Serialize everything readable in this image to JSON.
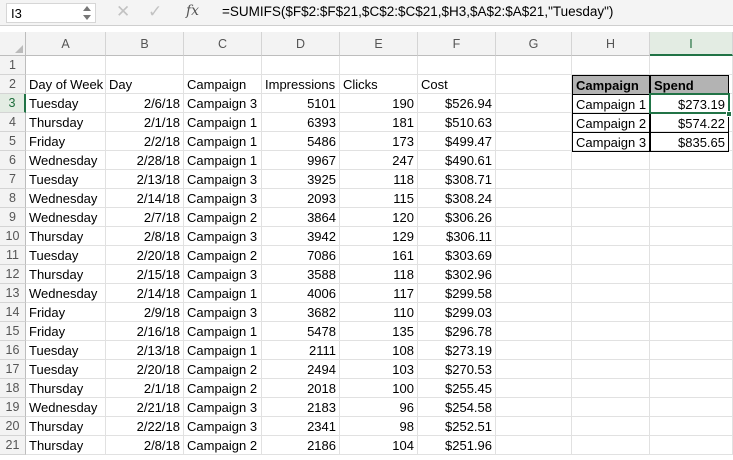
{
  "formula_bar": {
    "name_box": "I3",
    "cancel_icon": "x-icon",
    "enter_icon": "check-icon",
    "fx_label": "fx",
    "formula": "=SUMIFS($F$2:$F$21,$C$2:$C$21,$H3,$A$2:$A$21,\"Tuesday\")"
  },
  "sheet": {
    "columns": [
      "A",
      "B",
      "C",
      "D",
      "E",
      "F",
      "G",
      "H",
      "I"
    ],
    "rows": [
      "1",
      "2",
      "3",
      "4",
      "5",
      "6",
      "7",
      "8",
      "9",
      "10",
      "11",
      "12",
      "13",
      "14",
      "15",
      "16",
      "17",
      "18",
      "19",
      "20",
      "21"
    ],
    "selected_cell": "I3",
    "headers": [
      "Day of Week",
      "Day",
      "Campaign",
      "Impressions",
      "Clicks",
      "Cost"
    ],
    "data": [
      [
        "Tuesday",
        "2/6/18",
        "Campaign 3",
        "5101",
        "190",
        "$526.94"
      ],
      [
        "Thursday",
        "2/1/18",
        "Campaign 1",
        "6393",
        "181",
        "$510.63"
      ],
      [
        "Friday",
        "2/2/18",
        "Campaign 1",
        "5486",
        "173",
        "$499.47"
      ],
      [
        "Wednesday",
        "2/28/18",
        "Campaign 1",
        "9967",
        "247",
        "$490.61"
      ],
      [
        "Tuesday",
        "2/13/18",
        "Campaign 3",
        "3925",
        "118",
        "$308.71"
      ],
      [
        "Wednesday",
        "2/14/18",
        "Campaign 3",
        "2093",
        "115",
        "$308.24"
      ],
      [
        "Wednesday",
        "2/7/18",
        "Campaign 2",
        "3864",
        "120",
        "$306.26"
      ],
      [
        "Thursday",
        "2/8/18",
        "Campaign 3",
        "3942",
        "129",
        "$306.11"
      ],
      [
        "Tuesday",
        "2/20/18",
        "Campaign 2",
        "7086",
        "161",
        "$303.69"
      ],
      [
        "Thursday",
        "2/15/18",
        "Campaign 3",
        "3588",
        "118",
        "$302.96"
      ],
      [
        "Wednesday",
        "2/14/18",
        "Campaign 1",
        "4006",
        "117",
        "$299.58"
      ],
      [
        "Friday",
        "2/9/18",
        "Campaign 3",
        "3682",
        "110",
        "$299.03"
      ],
      [
        "Friday",
        "2/16/18",
        "Campaign 1",
        "5478",
        "135",
        "$296.78"
      ],
      [
        "Tuesday",
        "2/13/18",
        "Campaign 1",
        "2111",
        "108",
        "$273.19"
      ],
      [
        "Tuesday",
        "2/20/18",
        "Campaign 2",
        "2494",
        "103",
        "$270.53"
      ],
      [
        "Thursday",
        "2/1/18",
        "Campaign 2",
        "2018",
        "100",
        "$255.45"
      ],
      [
        "Wednesday",
        "2/21/18",
        "Campaign 3",
        "2183",
        "96",
        "$254.58"
      ],
      [
        "Thursday",
        "2/22/18",
        "Campaign 3",
        "2341",
        "98",
        "$252.51"
      ],
      [
        "Thursday",
        "2/8/18",
        "Campaign 2",
        "2186",
        "104",
        "$251.96"
      ]
    ],
    "summary": {
      "headers": [
        "Campaign",
        "Spend"
      ],
      "rows": [
        [
          "Campaign 1",
          "$273.19"
        ],
        [
          "Campaign 2",
          "$574.22"
        ],
        [
          "Campaign 3",
          "$835.65"
        ]
      ]
    }
  },
  "colors": {
    "selection": "#217346",
    "summary_header_bg": "#b3b3b3"
  }
}
